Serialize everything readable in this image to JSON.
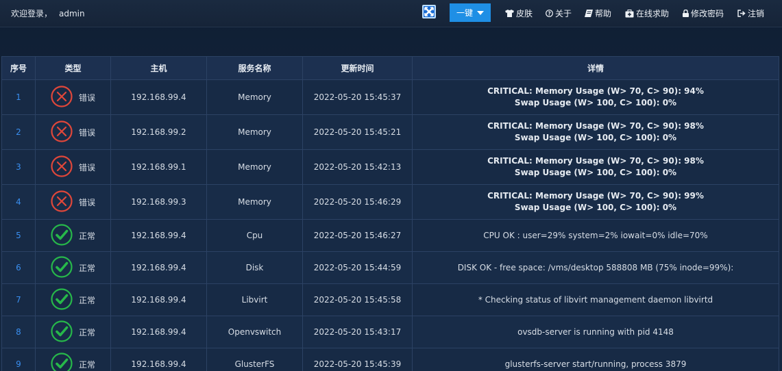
{
  "header": {
    "welcome": "欢迎登录，",
    "user": "admin",
    "onekey_label": "一键",
    "nav": [
      {
        "id": "skin",
        "label": "皮肤",
        "icon": "tshirt-icon"
      },
      {
        "id": "about",
        "label": "关于",
        "icon": "question-circle-icon"
      },
      {
        "id": "help",
        "label": "帮助",
        "icon": "book-icon"
      },
      {
        "id": "online-help",
        "label": "在线求助",
        "icon": "medkit-icon"
      },
      {
        "id": "change-password",
        "label": "修改密码",
        "icon": "lock-icon"
      },
      {
        "id": "logout",
        "label": "注销",
        "icon": "sign-out-icon"
      }
    ]
  },
  "table": {
    "headers": [
      "序号",
      "类型",
      "主机",
      "服务名称",
      "更新时间",
      "详情"
    ],
    "rows": [
      {
        "idx": "1",
        "status": "error",
        "type": "错误",
        "host": "192.168.99.4",
        "service": "Memory",
        "time": "2022-05-20 15:45:37",
        "detail": [
          "CRITICAL: Memory Usage (W> 70, C> 90): 94%",
          "Swap Usage (W> 100, C> 100): 0%"
        ]
      },
      {
        "idx": "2",
        "status": "error",
        "type": "错误",
        "host": "192.168.99.2",
        "service": "Memory",
        "time": "2022-05-20 15:45:21",
        "detail": [
          "CRITICAL: Memory Usage (W> 70, C> 90): 98%",
          "Swap Usage (W> 100, C> 100): 0%"
        ]
      },
      {
        "idx": "3",
        "status": "error",
        "type": "错误",
        "host": "192.168.99.1",
        "service": "Memory",
        "time": "2022-05-20 15:42:13",
        "detail": [
          "CRITICAL: Memory Usage (W> 70, C> 90): 98%",
          "Swap Usage (W> 100, C> 100): 0%"
        ]
      },
      {
        "idx": "4",
        "status": "error",
        "type": "错误",
        "host": "192.168.99.3",
        "service": "Memory",
        "time": "2022-05-20 15:46:29",
        "detail": [
          "CRITICAL: Memory Usage (W> 70, C> 90): 99%",
          "Swap Usage (W> 100, C> 100): 0%"
        ]
      },
      {
        "idx": "5",
        "status": "ok",
        "type": "正常",
        "host": "192.168.99.4",
        "service": "Cpu",
        "time": "2022-05-20 15:46:27",
        "detail": [
          "CPU OK : user=29% system=2% iowait=0% idle=70%"
        ]
      },
      {
        "idx": "6",
        "status": "ok",
        "type": "正常",
        "host": "192.168.99.4",
        "service": "Disk",
        "time": "2022-05-20 15:44:59",
        "detail": [
          "DISK OK - free space: /vms/desktop 588808 MB (75% inode=99%):"
        ]
      },
      {
        "idx": "7",
        "status": "ok",
        "type": "正常",
        "host": "192.168.99.4",
        "service": "Libvirt",
        "time": "2022-05-20 15:45:58",
        "detail": [
          "* Checking status of libvirt management daemon libvirtd"
        ]
      },
      {
        "idx": "8",
        "status": "ok",
        "type": "正常",
        "host": "192.168.99.4",
        "service": "Openvswitch",
        "time": "2022-05-20 15:43:17",
        "detail": [
          "ovsdb-server is running with pid 4148"
        ]
      },
      {
        "idx": "9",
        "status": "ok",
        "type": "正常",
        "host": "192.168.99.4",
        "service": "GlusterFS",
        "time": "2022-05-20 15:45:39",
        "detail": [
          "glusterfs-server start/running, process 3879"
        ]
      }
    ]
  },
  "colors": {
    "error": "#e0473a",
    "ok": "#27b84a",
    "accent": "#1f8fe5",
    "link": "#3a8ff0"
  }
}
